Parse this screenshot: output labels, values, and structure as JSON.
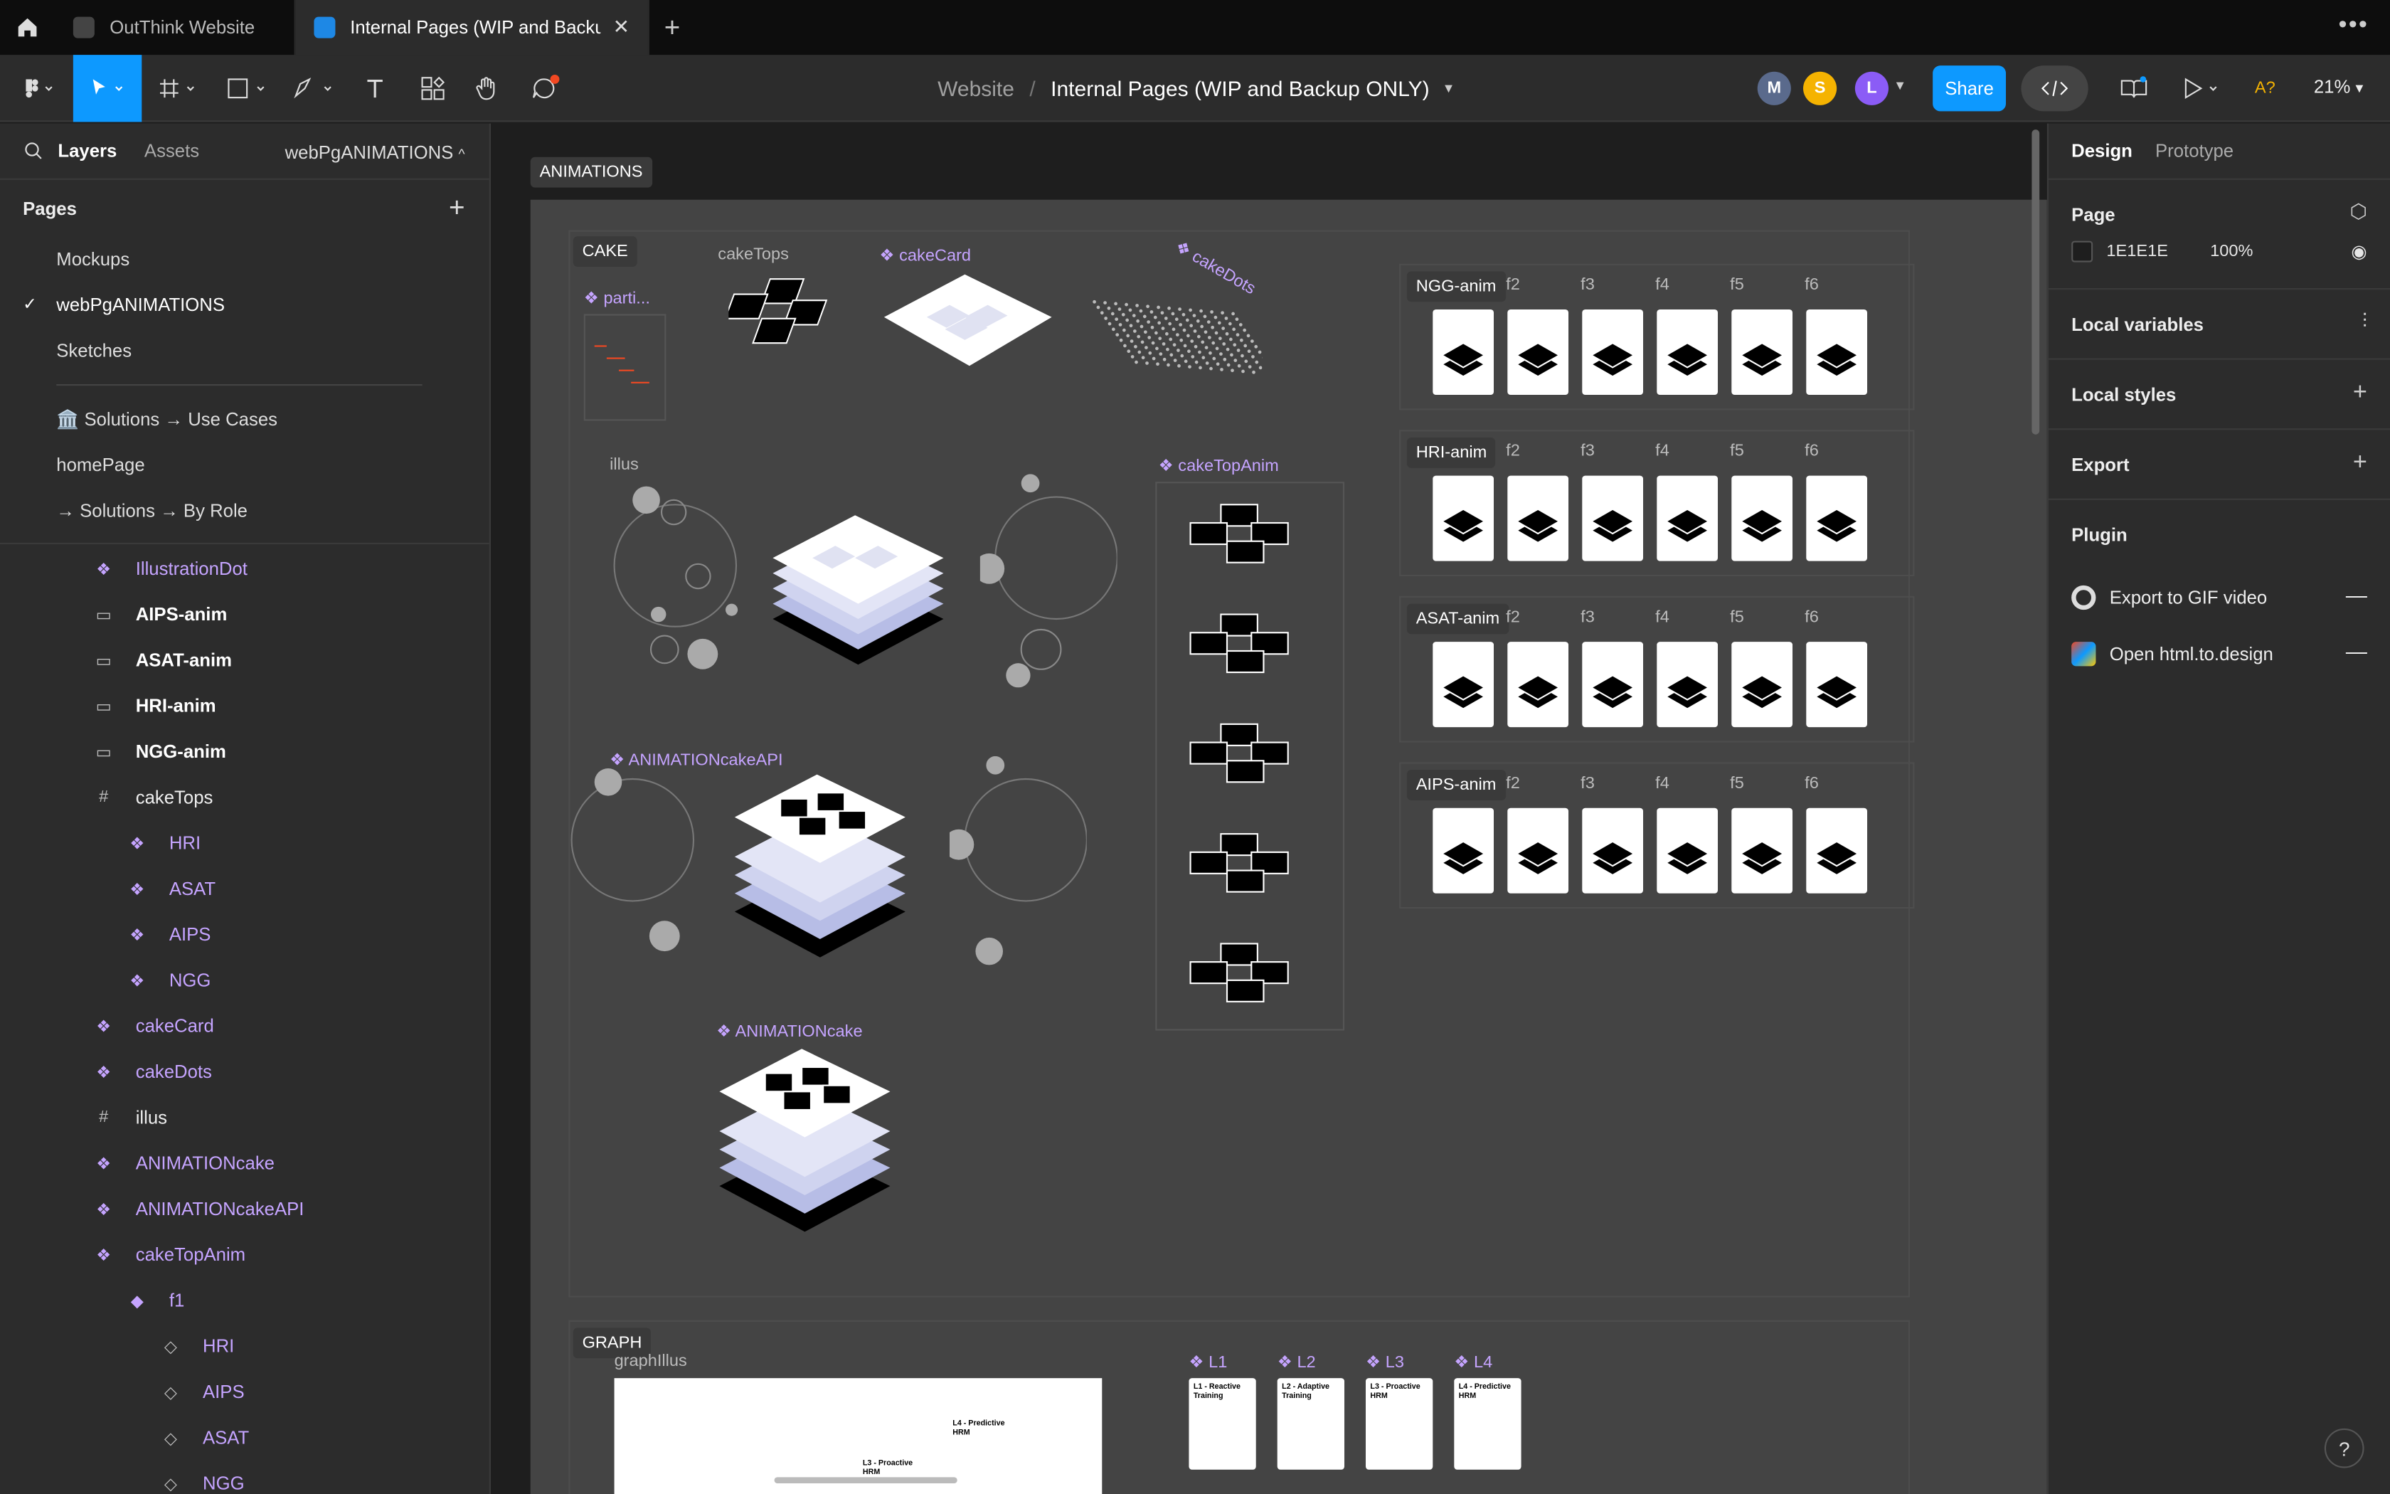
{
  "tabs": [
    {
      "label": "OutThink Website"
    },
    {
      "label": "Internal Pages (WIP and Backup O..."
    }
  ],
  "toolbar": {
    "project": "Website",
    "file": "Internal Pages (WIP and Backup ONLY)",
    "avatars": [
      {
        "initial": "M",
        "color": "#5a6a8c"
      },
      {
        "initial": "S",
        "color": "#f5b301"
      },
      {
        "initial": "L",
        "color": "#8b5cf6"
      }
    ],
    "share_label": "Share",
    "zoom": "21%",
    "ai_badge": "A?"
  },
  "left_panel": {
    "tab_layers": "Layers",
    "tab_assets": "Assets",
    "current_page": "webPgANIMATIONS",
    "pages_header": "Pages",
    "pages": [
      {
        "label": "Mockups"
      },
      {
        "label": "webPgANIMATIONS",
        "selected": true
      },
      {
        "label": "Sketches"
      },
      {
        "label": "🏛️ Solutions → Use Cases"
      },
      {
        "label": "homePage"
      },
      {
        "label": "→ Solutions → By Role"
      }
    ],
    "layers": [
      {
        "label": "IllustrationDot",
        "type": "component",
        "indent": 1
      },
      {
        "label": "AIPS-anim",
        "type": "frame",
        "indent": 1
      },
      {
        "label": "ASAT-anim",
        "type": "frame",
        "indent": 1
      },
      {
        "label": "HRI-anim",
        "type": "frame",
        "indent": 1
      },
      {
        "label": "NGG-anim",
        "type": "frame",
        "indent": 1
      },
      {
        "label": "cakeTops",
        "type": "grid",
        "indent": 1
      },
      {
        "label": "HRI",
        "type": "component",
        "indent": 2
      },
      {
        "label": "ASAT",
        "type": "component",
        "indent": 2
      },
      {
        "label": "AIPS",
        "type": "component",
        "indent": 2
      },
      {
        "label": "NGG",
        "type": "component",
        "indent": 2
      },
      {
        "label": "cakeCard",
        "type": "component",
        "indent": 1
      },
      {
        "label": "cakeDots",
        "type": "component",
        "indent": 1
      },
      {
        "label": "illus",
        "type": "grid",
        "indent": 1
      },
      {
        "label": "ANIMATIONcake",
        "type": "component",
        "indent": 1
      },
      {
        "label": "ANIMATIONcakeAPI",
        "type": "component",
        "indent": 1
      },
      {
        "label": "cakeTopAnim",
        "type": "component",
        "indent": 1
      },
      {
        "label": "f1",
        "type": "variant",
        "indent": 2
      },
      {
        "label": "HRI",
        "type": "instance",
        "indent": 3
      },
      {
        "label": "AIPS",
        "type": "instance",
        "indent": 3
      },
      {
        "label": "ASAT",
        "type": "instance",
        "indent": 3
      },
      {
        "label": "NGG",
        "type": "instance",
        "indent": 3
      }
    ]
  },
  "right_panel": {
    "tab_design": "Design",
    "tab_prototype": "Prototype",
    "page_header": "Page",
    "page_color": "1E1E1E",
    "page_opacity": "100%",
    "local_variables": "Local variables",
    "local_styles": "Local styles",
    "export": "Export",
    "plugin_header": "Plugin",
    "plugins": [
      {
        "label": "Export to GIF video"
      },
      {
        "label": "Open html.to.design"
      }
    ]
  },
  "canvas": {
    "animations_tag": "ANIMATIONS",
    "cake_tag": "CAKE",
    "graph_tag": "GRAPH",
    "labels": {
      "cakeTops": "cakeTops",
      "cakeCard": "cakeCard",
      "cakeDots": "cakeDots",
      "parti": "parti...",
      "illus": "illus",
      "cakeTopAnim": "cakeTopAnim",
      "animCakeAPI": "ANIMATIONcakeAPI",
      "animCake": "ANIMATIONcake",
      "graphIllus": "graphIllus"
    },
    "anim_rows": [
      {
        "name": "NGG-anim"
      },
      {
        "name": "HRI-anim"
      },
      {
        "name": "ASAT-anim"
      },
      {
        "name": "AIPS-anim"
      }
    ],
    "frame_labels": [
      "f2",
      "f3",
      "f4",
      "f5",
      "f6"
    ],
    "graph_levels": [
      {
        "name": "L1",
        "title": "L1 - Reactive Training"
      },
      {
        "name": "L2",
        "title": "L2 - Adaptive Training"
      },
      {
        "name": "L3",
        "title": "L3 - Proactive HRM"
      },
      {
        "name": "L4",
        "title": "L4 - Predictive HRM"
      }
    ],
    "graph_inner_l3": "L3 - Proactive HRM",
    "graph_inner_l4": "L4 - Predictive HRM"
  }
}
